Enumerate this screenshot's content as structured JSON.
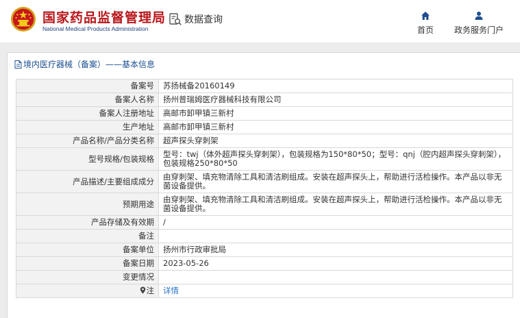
{
  "header": {
    "site_name_cn": "国家药品监督管理局",
    "site_name_en": "National Medical Products Administration",
    "query_label": "数据查询",
    "nav": [
      {
        "label": "首页",
        "icon": "home-icon"
      },
      {
        "label": "政务服务门户",
        "icon": "user-icon"
      }
    ]
  },
  "breadcrumb": "境内医疗器械（备案）——基本信息",
  "details": {
    "record_no": {
      "label": "备案号",
      "value": "苏扬械备20160149"
    },
    "filer_name": {
      "label": "备案人名称",
      "value": "扬州普瑞姆医疗器械科技有限公司"
    },
    "filer_address": {
      "label": "备案人注册地址",
      "value": "高邮市卸甲镇三新村"
    },
    "production_address": {
      "label": "生产地址",
      "value": "高邮市卸甲镇三新村"
    },
    "product_name": {
      "label": "产品名称/产品分类名称",
      "value": "超声探头穿刺架"
    },
    "model_spec": {
      "label": "型号规格/包装规格",
      "value": "型号：twj（体外超声探头穿刺架），包装规格为150*80*50；型号：qnj（腔内超声探头穿刺架），包装规格250*80*50"
    },
    "description": {
      "label": "产品描述/主要组成成分",
      "value": "由穿刺架、填充物清除工具和清洁刷组成。安装在超声探头上，帮助进行活检操作。本产品以非无菌设备提供。"
    },
    "intended_use": {
      "label": "预期用途",
      "value": "由穿刺架、填充物清除工具和清洁刷组成。安装在超声探头上，帮助进行活检操作。本产品以非无菌设备提供。"
    },
    "storage": {
      "label": "产品存储及有效期",
      "value": "/"
    },
    "remarks": {
      "label": "备注",
      "value": ""
    },
    "record_unit": {
      "label": "备案单位",
      "value": "扬州市行政审批局"
    },
    "record_date": {
      "label": "备案日期",
      "value": "2023-05-26"
    },
    "changes": {
      "label": "变更情况",
      "value": ""
    },
    "note": {
      "label": "注",
      "value": "详情"
    }
  },
  "colors": {
    "brand_red": "#b8161a",
    "brand_blue": "#1e3f7a",
    "link_blue": "#2a72c9",
    "label_bg": "#f2f2f2",
    "page_bg": "#ececec"
  }
}
